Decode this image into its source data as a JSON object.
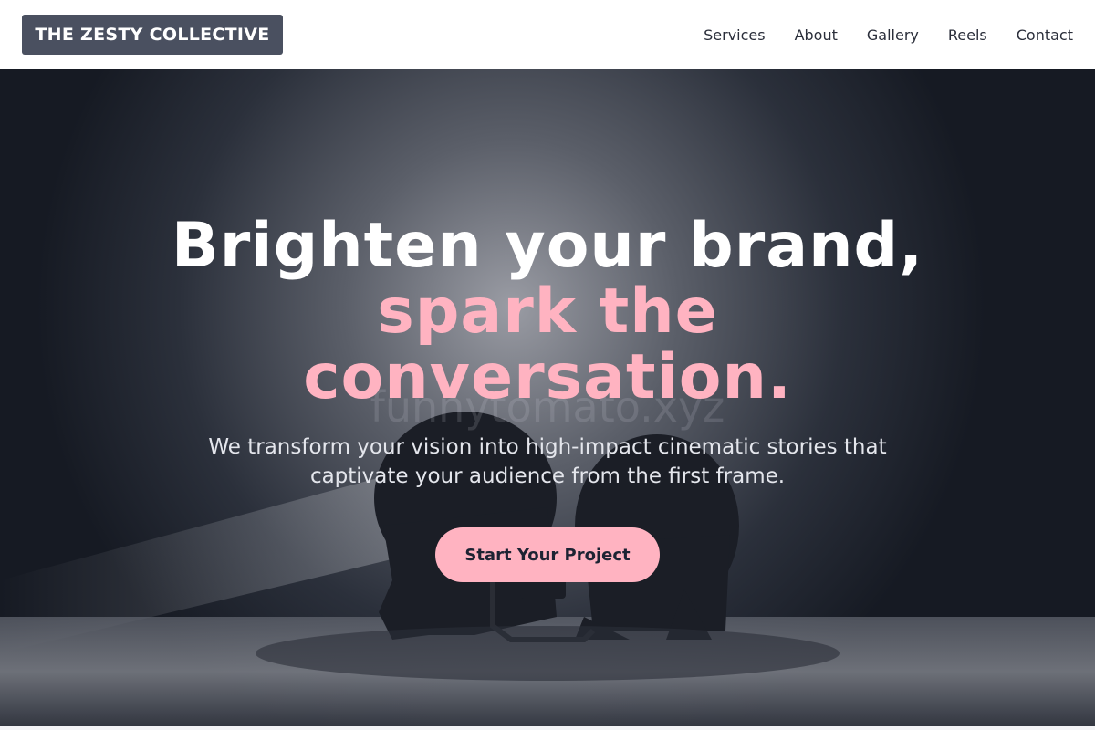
{
  "header": {
    "logo": "THE ZESTY COLLECTIVE",
    "nav": [
      "Services",
      "About",
      "Gallery",
      "Reels",
      "Contact"
    ]
  },
  "hero": {
    "headline_line1": "Brighten your brand,",
    "headline_line2": "spark the",
    "headline_line3": "conversation.",
    "watermark": "funnytomato.xyz",
    "subtext": "We transform your vision into high-impact cinematic stories that captivate your audience from the first frame.",
    "cta": "Start Your Project"
  },
  "colors": {
    "accent": "#ffb3c1",
    "logo_bg": "#4a5060",
    "hero_bg": "#181c26"
  }
}
